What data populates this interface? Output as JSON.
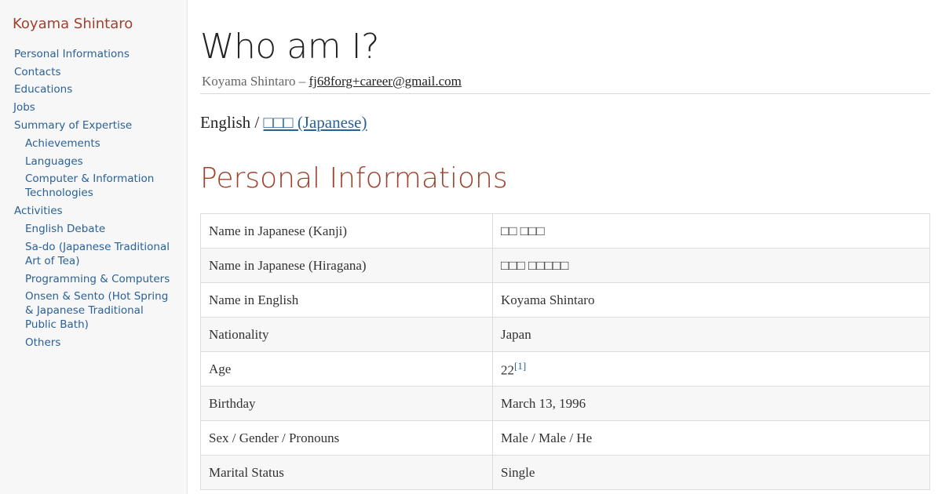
{
  "sidebar": {
    "site_title": "Koyama Shintaro",
    "toc": [
      {
        "label": "Personal Informations",
        "level": 1
      },
      {
        "label": "Contacts",
        "level": 1
      },
      {
        "label": "Educations",
        "level": 1
      },
      {
        "label": "Jobs",
        "level": 1
      },
      {
        "label": "Summary of Expertise",
        "level": 1
      },
      {
        "label": "Achievements",
        "level": 2
      },
      {
        "label": "Languages",
        "level": 2
      },
      {
        "label": "Computer & Information Technologies",
        "level": 2
      },
      {
        "label": "Activities",
        "level": 1
      },
      {
        "label": "English Debate",
        "level": 2
      },
      {
        "label": "Sa-do (Japanese Traditional Art of Tea)",
        "level": 2
      },
      {
        "label": "Programming & Computers",
        "level": 2
      },
      {
        "label": "Onsen & Sento (Hot Spring & Japanese Traditional Public Bath)",
        "level": 2
      },
      {
        "label": "Others",
        "level": 2
      }
    ]
  },
  "main": {
    "title": "Who am I?",
    "byline": {
      "name": "Koyama Shintaro",
      "separator": " – ",
      "email": "fj68forg+career@gmail.com"
    },
    "language": {
      "current": "English",
      "separator": " / ",
      "alternate_link": "□□□ (Japanese)"
    },
    "section_title": "Personal Informations",
    "table": [
      {
        "key": "Name in Japanese (Kanji)",
        "value": "□□ □□□"
      },
      {
        "key": "Name in Japanese (Hiragana)",
        "value": "□□□ □□□□□"
      },
      {
        "key": "Name in English",
        "value": "Koyama Shintaro"
      },
      {
        "key": "Nationality",
        "value": "Japan"
      },
      {
        "key": "Age",
        "value": "22",
        "footnote": "[1]"
      },
      {
        "key": "Birthday",
        "value": "March 13, 1996"
      },
      {
        "key": "Sex / Gender / Pronouns",
        "value": "Male / Male / He"
      },
      {
        "key": "Marital Status",
        "value": "Single"
      }
    ]
  }
}
